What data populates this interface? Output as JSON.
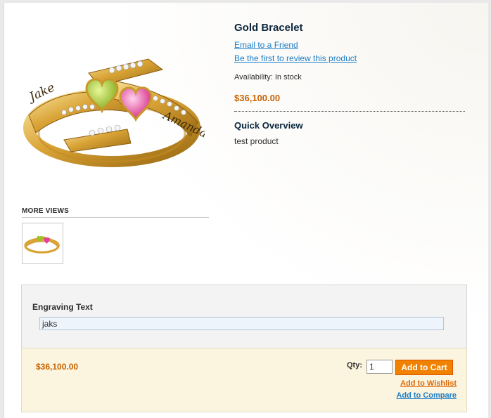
{
  "product": {
    "name": "Gold Bracelet",
    "email_link": "Email to a Friend",
    "review_link": "Be the first to review this product",
    "availability": "Availability: In stock",
    "price": "$36,100.00",
    "overview_title": "Quick Overview",
    "overview_text": "test product",
    "image_engravings": [
      "Jake",
      "Amanda"
    ]
  },
  "more_views": {
    "title": "MORE VIEWS"
  },
  "options": {
    "engraving_label": "Engraving Text",
    "engraving_value": "jaks"
  },
  "cart": {
    "price": "$36,100.00",
    "qty_label": "Qty:",
    "qty_value": "1",
    "add_to_cart": "Add to Cart",
    "wishlist_link": "Add to Wishlist",
    "compare_link": "Add to Compare"
  },
  "colors": {
    "price": "#c76200",
    "link": "#1e7ec8",
    "button": "#f18200",
    "wishlist_link": "#dc6809"
  }
}
